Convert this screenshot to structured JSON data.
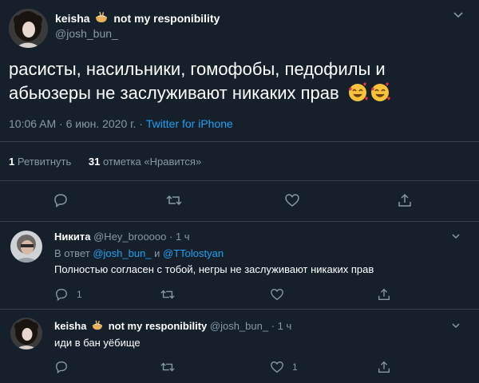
{
  "main_tweet": {
    "display_name": "keisha",
    "display_name_suffix": "not my responibility",
    "handle": "@josh_bun_",
    "text": "расисты, насильники, гомофобы, педофилы и абьюзеры не заслуживают никаких прав",
    "text_line1": "расисты, насильники, гомофобы, педофилы и",
    "text_line2": "абьюзеры не заслуживают никаких прав",
    "emoji": "smiling-face-with-hearts x2",
    "timestamp": "10:06 AM · 6 июн. 2020 г. · ",
    "source": "Twitter for iPhone",
    "retweets_count": "1",
    "retweets_label": "Ретвитнуть",
    "likes_count": "31",
    "likes_label": "отметка «Нравится»"
  },
  "reply1": {
    "display_name": "Никита",
    "handle": "@Hey_brooooo",
    "time": "· 1 ч",
    "reply_prefix": "В ответ",
    "mention1": "@josh_bun_",
    "and": "и",
    "mention2": "@TTolostyan",
    "text": "Полностью согласен с тобой, негры не заслуживают никаких прав",
    "reply_count": "1",
    "retweet_count": "",
    "like_count": ""
  },
  "reply2": {
    "display_name": "keisha",
    "display_name_suffix": "not my responibility",
    "handle": "@josh_bun_",
    "time": "· 1 ч",
    "text": "иди в бан уёбище",
    "reply_count": "",
    "retweet_count": "",
    "like_count": "1"
  },
  "colors": {
    "background": "#15202b",
    "muted": "#8899a6",
    "link": "#1da1f2",
    "divider": "#38444d"
  }
}
